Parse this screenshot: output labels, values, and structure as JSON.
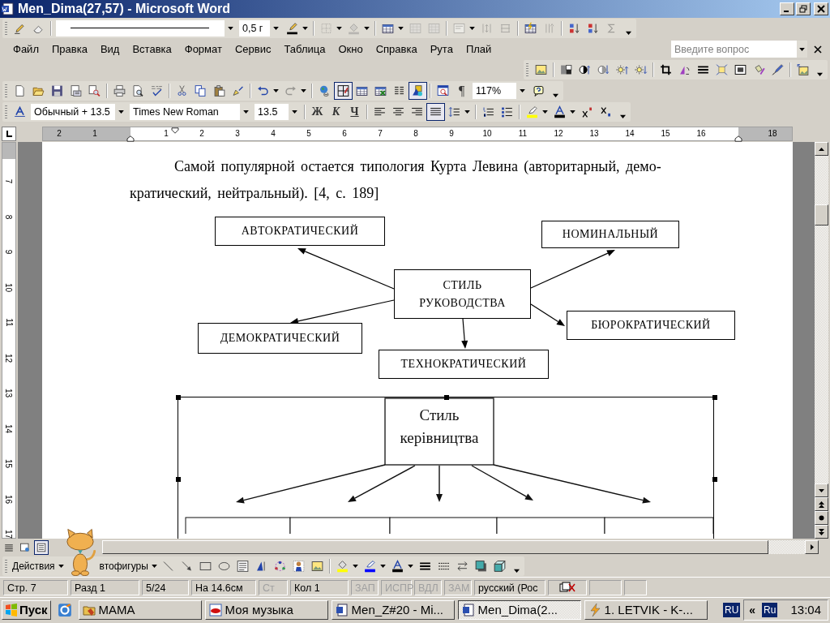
{
  "window": {
    "title": "Men_Dima(27,57) - Microsoft Word"
  },
  "toolbars": {
    "tables": [
      {
        "kind": "pencil",
        "pressed": false,
        "disabled": false
      },
      {
        "kind": "eraser",
        "pressed": false,
        "disabled": false
      },
      {
        "kind": "sep"
      },
      {
        "kind": "line-style-box"
      },
      {
        "kind": "weight-box",
        "value": "0,5 г"
      },
      {
        "kind": "linecolor",
        "pressed": false,
        "disabled": false
      },
      {
        "kind": "caret"
      },
      {
        "kind": "sep"
      },
      {
        "kind": "borders",
        "pressed": false,
        "disabled": true
      },
      {
        "kind": "caret"
      },
      {
        "kind": "bucket",
        "pressed": false,
        "disabled": true
      },
      {
        "kind": "caret"
      },
      {
        "kind": "sep"
      },
      {
        "kind": "table",
        "pressed": false,
        "disabled": false
      },
      {
        "kind": "caret"
      },
      {
        "kind": "gridgrey",
        "pressed": false,
        "disabled": true
      },
      {
        "kind": "gridgrey",
        "pressed": false,
        "disabled": true
      },
      {
        "kind": "sep"
      },
      {
        "kind": "cellalign",
        "pressed": false,
        "disabled": true
      },
      {
        "kind": "caret"
      },
      {
        "kind": "distrows",
        "pressed": false,
        "disabled": true
      },
      {
        "kind": "distcols",
        "pressed": false,
        "disabled": true
      },
      {
        "kind": "sep"
      },
      {
        "kind": "autoformat",
        "pressed": false,
        "disabled": false
      },
      {
        "kind": "textdir",
        "pressed": false,
        "disabled": true
      },
      {
        "kind": "sep"
      },
      {
        "kind": "sortasc",
        "pressed": false,
        "disabled": false
      },
      {
        "kind": "sortdesc",
        "pressed": false,
        "disabled": false
      },
      {
        "kind": "sum",
        "pressed": false,
        "disabled": true
      },
      {
        "kind": "overflow"
      }
    ],
    "picture": [
      {
        "kind": "insertpic",
        "pressed": false,
        "disabled": false
      },
      {
        "kind": "sep"
      },
      {
        "kind": "color",
        "pressed": false,
        "disabled": false
      },
      {
        "kind": "contrastup",
        "pressed": false,
        "disabled": false
      },
      {
        "kind": "contrastdown",
        "pressed": false,
        "disabled": false
      },
      {
        "kind": "brightup",
        "pressed": false,
        "disabled": false
      },
      {
        "kind": "brightdown",
        "pressed": false,
        "disabled": false
      },
      {
        "kind": "sep"
      },
      {
        "kind": "crop",
        "pressed": false,
        "disabled": false
      },
      {
        "kind": "rotate",
        "pressed": false,
        "disabled": false
      },
      {
        "kind": "linestyle",
        "pressed": false,
        "disabled": false
      },
      {
        "kind": "compress",
        "pressed": false,
        "disabled": false
      },
      {
        "kind": "wrap",
        "pressed": false,
        "disabled": false
      },
      {
        "kind": "formatpic",
        "pressed": false,
        "disabled": false
      },
      {
        "kind": "transparent",
        "pressed": false,
        "disabled": false
      },
      {
        "kind": "sep"
      },
      {
        "kind": "resetpic",
        "pressed": false,
        "disabled": false
      },
      {
        "kind": "overflow"
      }
    ],
    "standard": [
      {
        "kind": "new",
        "pressed": false,
        "disabled": false
      },
      {
        "kind": "open",
        "pressed": false,
        "disabled": false
      },
      {
        "kind": "save",
        "pressed": false,
        "disabled": false
      },
      {
        "kind": "permission",
        "pressed": false,
        "disabled": false
      },
      {
        "kind": "research",
        "pressed": false,
        "disabled": false
      },
      {
        "kind": "sep"
      },
      {
        "kind": "print",
        "pressed": false,
        "disabled": false
      },
      {
        "kind": "preview",
        "pressed": false,
        "disabled": false
      },
      {
        "kind": "spelling",
        "pressed": false,
        "disabled": false
      },
      {
        "kind": "sep"
      },
      {
        "kind": "cut",
        "pressed": false,
        "disabled": false
      },
      {
        "kind": "copy",
        "pressed": false,
        "disabled": false
      },
      {
        "kind": "paste",
        "pressed": false,
        "disabled": false
      },
      {
        "kind": "brush",
        "pressed": false,
        "disabled": false
      },
      {
        "kind": "sep"
      },
      {
        "kind": "undo",
        "pressed": false,
        "disabled": false
      },
      {
        "kind": "caret"
      },
      {
        "kind": "redo",
        "pressed": false,
        "disabled": true
      },
      {
        "kind": "caret"
      },
      {
        "kind": "sep"
      },
      {
        "kind": "hyperlink",
        "pressed": false,
        "disabled": false
      },
      {
        "kind": "tablesborders",
        "pressed": true,
        "disabled": false
      },
      {
        "kind": "table",
        "pressed": false,
        "disabled": false
      },
      {
        "kind": "excel",
        "pressed": false,
        "disabled": false
      },
      {
        "kind": "columns",
        "pressed": false,
        "disabled": false
      },
      {
        "kind": "drawing",
        "pressed": true,
        "disabled": false
      },
      {
        "kind": "sep"
      },
      {
        "kind": "docmap",
        "pressed": false,
        "disabled": false
      },
      {
        "kind": "marks",
        "label": "¶",
        "pressed": false
      },
      {
        "kind": "zoom-box",
        "value": "117%"
      },
      {
        "kind": "help",
        "pressed": false,
        "disabled": false
      },
      {
        "kind": "overflow"
      }
    ],
    "formatting": [
      {
        "kind": "styles",
        "pressed": false,
        "disabled": false
      },
      {
        "kind": "style-box",
        "value": "Обычный + 13.5"
      },
      {
        "kind": "font-box",
        "value": "Times New Roman"
      },
      {
        "kind": "size-box",
        "value": "13.5"
      },
      {
        "kind": "sep"
      },
      {
        "kind": "bold",
        "label": "Ж",
        "pressed": false
      },
      {
        "kind": "italic",
        "label": "К",
        "pressed": false
      },
      {
        "kind": "underline",
        "label": "Ч",
        "pressed": false
      },
      {
        "kind": "sep"
      },
      {
        "kind": "alignleft",
        "pressed": false,
        "disabled": false
      },
      {
        "kind": "aligncenter",
        "pressed": false,
        "disabled": false
      },
      {
        "kind": "alignright",
        "pressed": false,
        "disabled": false
      },
      {
        "kind": "justify",
        "pressed": true,
        "disabled": false
      },
      {
        "kind": "linespacing",
        "pressed": false,
        "disabled": false
      },
      {
        "kind": "caret"
      },
      {
        "kind": "sep"
      },
      {
        "kind": "numbering",
        "pressed": false,
        "disabled": false
      },
      {
        "kind": "bullets",
        "pressed": false,
        "disabled": false
      },
      {
        "kind": "sep"
      },
      {
        "kind": "highlight",
        "pressed": false,
        "disabled": false
      },
      {
        "kind": "caret"
      },
      {
        "kind": "fontcolor",
        "pressed": false,
        "disabled": false
      },
      {
        "kind": "caret"
      },
      {
        "kind": "superscript",
        "pressed": false,
        "disabled": false
      },
      {
        "kind": "subscript",
        "pressed": false,
        "disabled": false
      },
      {
        "kind": "overflow"
      }
    ],
    "drawing": [
      {
        "kind": "menu",
        "label": "Действия"
      },
      {
        "kind": "gap"
      },
      {
        "kind": "menu",
        "label": "втофигуры"
      },
      {
        "kind": "line",
        "pressed": false,
        "disabled": false
      },
      {
        "kind": "arrow",
        "pressed": false,
        "disabled": false
      },
      {
        "kind": "rect",
        "pressed": false,
        "disabled": false
      },
      {
        "kind": "oval",
        "pressed": false,
        "disabled": false
      },
      {
        "kind": "textbox",
        "pressed": false,
        "disabled": false
      },
      {
        "kind": "wordart",
        "pressed": false,
        "disabled": false
      },
      {
        "kind": "diagram",
        "pressed": false,
        "disabled": false
      },
      {
        "kind": "clipart",
        "pressed": false,
        "disabled": false
      },
      {
        "kind": "insertpic",
        "pressed": false,
        "disabled": false
      },
      {
        "kind": "sep"
      },
      {
        "kind": "fill",
        "pressed": false,
        "disabled": false
      },
      {
        "kind": "caret"
      },
      {
        "kind": "linecolor2",
        "pressed": false,
        "disabled": false
      },
      {
        "kind": "caret"
      },
      {
        "kind": "fontcolor",
        "pressed": false,
        "disabled": false
      },
      {
        "kind": "caret"
      },
      {
        "kind": "linestyle",
        "pressed": false,
        "disabled": false
      },
      {
        "kind": "dash",
        "pressed": false,
        "disabled": false
      },
      {
        "kind": "arrows",
        "pressed": false,
        "disabled": false
      },
      {
        "kind": "shadow",
        "pressed": false,
        "disabled": false
      },
      {
        "kind": "cube",
        "pressed": false,
        "disabled": false
      },
      {
        "kind": "overflow"
      }
    ]
  },
  "menu": {
    "items": [
      "Файл",
      "Правка",
      "Вид",
      "Вставка",
      "Формат",
      "Сервис",
      "Таблица",
      "Окно",
      "Справка",
      "Рута",
      "Плай"
    ],
    "help_search": {
      "placeholder": "Введите вопрос"
    }
  },
  "ruler": {
    "labels": [
      "2",
      "1",
      "1",
      "2",
      "3",
      "4",
      "5",
      "6",
      "7",
      "8",
      "9",
      "10",
      "11",
      "12",
      "13",
      "14",
      "15",
      "16",
      "18"
    ]
  },
  "vertical_ruler": {
    "labels": [
      "7",
      "8",
      "9",
      "10",
      "11",
      "12",
      "13",
      "14",
      "15",
      "16",
      "17"
    ]
  },
  "document": {
    "paragraph": "Самой популярной остается типология Курта Левина (авторитарный, демо-\nкратический, нейтральный). [4, с. 189]",
    "diagram": {
      "center": [
        "СТИЛЬ",
        "РУКОВОДСТВА"
      ],
      "nodes": [
        {
          "label": "АВТОКРАТИЧЕСКИЙ"
        },
        {
          "label": "НОМИНАЛЬНЫЙ"
        },
        {
          "label": "БЮРОКРАТИЧЕСКИЙ"
        },
        {
          "label": "ДЕМОКРАТИЧЕСКИЙ"
        },
        {
          "label": "ТЕХНОКРАТИЧЕСКИЙ"
        }
      ]
    },
    "image": {
      "title_lines": [
        "Стиль",
        "керівництва"
      ]
    }
  },
  "views": [
    {
      "kind": "normal",
      "selected": false
    },
    {
      "kind": "web",
      "selected": false
    },
    {
      "kind": "print",
      "selected": true
    }
  ],
  "status_bar": [
    {
      "text": "Стр. 7",
      "disabled": false
    },
    {
      "text": "Разд 1",
      "disabled": false
    },
    {
      "text": "5/24",
      "disabled": false
    },
    {
      "text": "На 14.6см",
      "disabled": false
    },
    {
      "text": "Ст",
      "disabled": true
    },
    {
      "text": "Кол 1",
      "disabled": false
    },
    {
      "text": "ЗАП",
      "disabled": true
    },
    {
      "text": "ИСПР",
      "disabled": true
    },
    {
      "text": "ВДЛ",
      "disabled": true
    },
    {
      "text": "ЗАМ",
      "disabled": true
    },
    {
      "text": "русский (Рос",
      "disabled": false
    }
  ],
  "taskbar": {
    "start": "Пуск",
    "items": [
      {
        "kind": "folder",
        "label": "MAMA",
        "selected": false
      },
      {
        "kind": "media",
        "label": "Моя музыка",
        "selected": false
      },
      {
        "kind": "word",
        "label": "Men_Z#20 - Mi...",
        "selected": false
      },
      {
        "kind": "word",
        "label": "Men_Dima(2...",
        "selected": true
      },
      {
        "kind": "lightning",
        "label": "1. LETVIK - K-...",
        "selected": false
      }
    ],
    "language": "RU",
    "tray_toggle": "«",
    "tray_language": "Ru",
    "clock": "13:04"
  }
}
